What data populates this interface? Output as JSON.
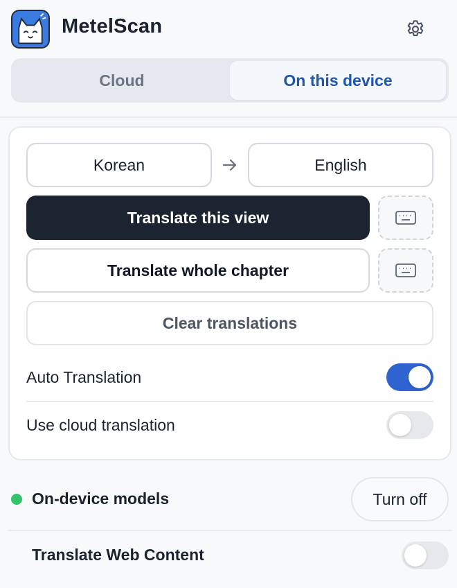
{
  "app": {
    "title": "MetelScan"
  },
  "tabs": {
    "cloud": "Cloud",
    "device": "On this device",
    "active": "device"
  },
  "languages": {
    "source": "Korean",
    "target": "English"
  },
  "buttons": {
    "translate_view": "Translate this view",
    "translate_chapter": "Translate whole chapter",
    "clear": "Clear translations"
  },
  "settings": {
    "auto_translation": {
      "label": "Auto Translation",
      "enabled": true
    },
    "cloud_translation": {
      "label": "Use cloud translation",
      "enabled": false
    }
  },
  "models": {
    "label": "On-device models",
    "status": "active",
    "action": "Turn off"
  },
  "web_content": {
    "label": "Translate Web Content",
    "enabled": false
  },
  "colors": {
    "accent": "#2f63d0",
    "status_green": "#34c36a",
    "primary_button": "#1b2430",
    "tab_active_text": "#1e56a8"
  },
  "icons": {
    "settings": "gear-icon",
    "arrow": "arrow-right-icon",
    "keyboard": "keyboard-icon",
    "logo": "cat-logo-icon"
  }
}
